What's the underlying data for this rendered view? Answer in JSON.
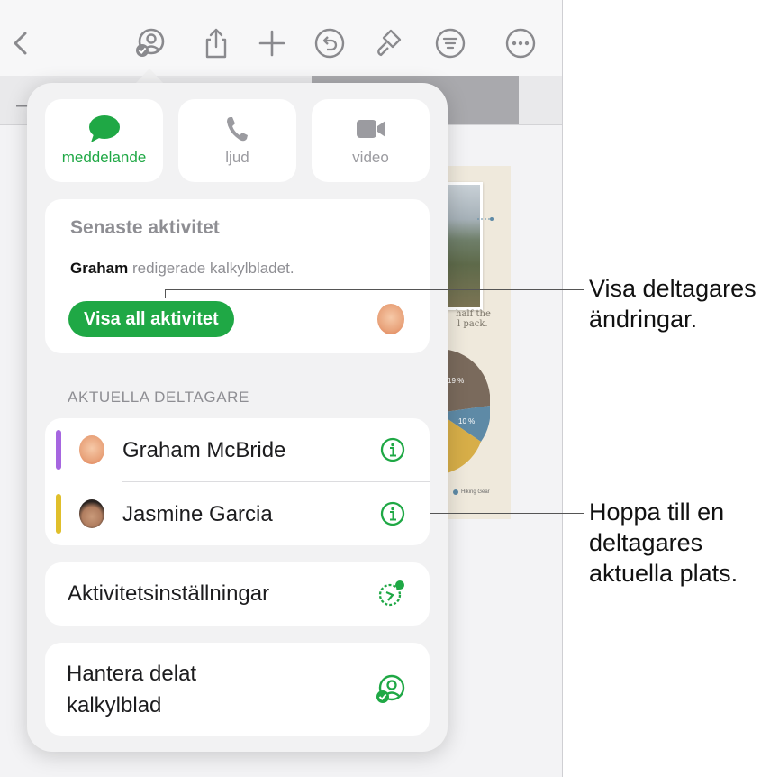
{
  "colors": {
    "accent_green": "#1fa845",
    "graham_bar": "#a666e0",
    "jasmine_bar": "#e0bf2b"
  },
  "toolbar": {
    "icons": [
      "chevron-left-icon",
      "collaboration-icon",
      "share-icon",
      "plus-icon",
      "undo-icon",
      "format-brush-icon",
      "organize-icon",
      "more-icon"
    ]
  },
  "document": {
    "sheet_caption_line1": "half the",
    "sheet_caption_line2": "l pack.",
    "pie_label_1": "19 %",
    "pie_label_2": "10 %",
    "legend_label": "Hiking Gear"
  },
  "popover": {
    "comm": {
      "message_label": "meddelande",
      "audio_label": "ljud",
      "video_label": "video"
    },
    "activity": {
      "title": "Senaste aktivitet",
      "actor": "Graham",
      "action": "redigerade kalkylbladet.",
      "button_label": "Visa all aktivitet"
    },
    "participants_header": "AKTUELLA DELTAGARE",
    "participants": [
      {
        "name": "Graham McBride"
      },
      {
        "name": "Jasmine Garcia"
      }
    ],
    "activity_settings_label": "Aktivitetsinställningar",
    "manage_line1": "Hantera delat",
    "manage_line2": "kalkylblad"
  },
  "callouts": {
    "show_changes_line1": "Visa deltagares",
    "show_changes_line2": "ändringar.",
    "jump_line1": "Hoppa till en",
    "jump_line2": "deltagares",
    "jump_line3": "aktuella plats."
  }
}
